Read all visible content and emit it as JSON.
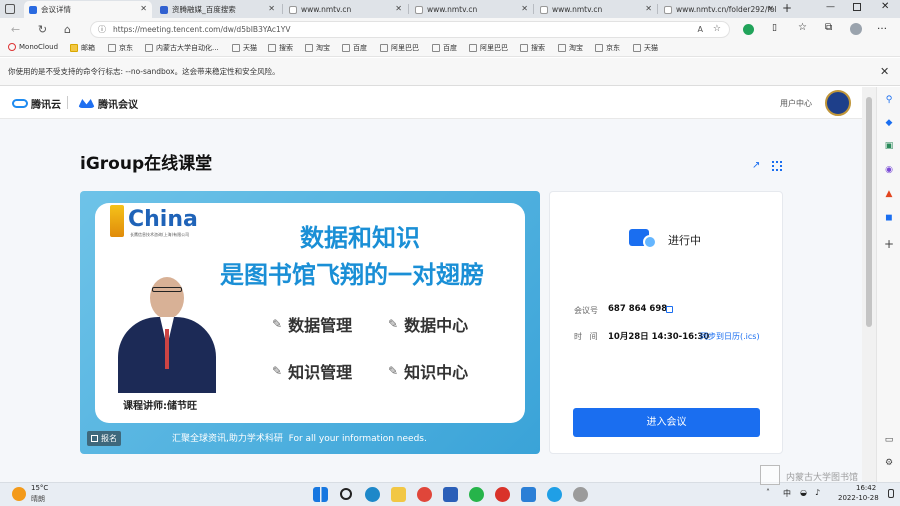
{
  "browser": {
    "tabs": [
      {
        "title": "会议详情",
        "active": true,
        "color": "#2a6ae0"
      },
      {
        "title": "资腾融媒_百度搜索",
        "color": "#3060d0"
      },
      {
        "title": "www.nmtv.cn",
        "color": "#999999"
      },
      {
        "title": "www.nmtv.cn",
        "color": "#999999"
      },
      {
        "title": "www.nmtv.cn",
        "color": "#999999"
      },
      {
        "title": "www.nmtv.cn/folder292/fol",
        "color": "#999999"
      }
    ],
    "url": "https://meeting.tencent.com/dw/d5bIB3YAc1YV",
    "bookmarks": [
      "MonoCloud",
      "邮箱",
      "京东",
      "内蒙古大学自动化...",
      "天猫",
      "搜索",
      "淘宝",
      "百度",
      "阿里巴巴",
      "百度",
      "阿里巴巴",
      "搜索",
      "淘宝",
      "京东",
      "天猫"
    ],
    "infobar_text": "你使用的是不受支持的命令行标志: --no-sandbox。这会带来稳定性和安全风险。"
  },
  "site": {
    "logo1": "腾讯云",
    "logo2": "腾讯会议",
    "user_center": "用户中心"
  },
  "page": {
    "title": "iGroup在线课堂"
  },
  "banner": {
    "brand": "China",
    "brand_sub": "长鹰信息技术咨询(上海)有限公司",
    "headline1": "数据和知识",
    "headline2": "是图书馆飞翔的一对翅膀",
    "features": [
      "数据管理",
      "数据中心",
      "知识管理",
      "知识中心"
    ],
    "lecturer": "课程讲师:储节旺",
    "slogan": "汇聚全球资讯,助力学术科研  For all your information needs.",
    "register": "报名"
  },
  "meeting": {
    "status": "进行中",
    "id_label": "会议号",
    "id_value": "687 864 698",
    "time_label": "时   间",
    "time_value": "10月28日 14:30-16:30",
    "sync": "同步到日历(.ics)",
    "join_button": "进入会议",
    "accent": "#1a6ef0"
  },
  "taskbar": {
    "weather_temp": "15°C",
    "weather_desc": "晴朗",
    "time": "16:42",
    "date": "2022-10-28",
    "ime": "中",
    "watermark": "内蒙古大学图书馆"
  }
}
